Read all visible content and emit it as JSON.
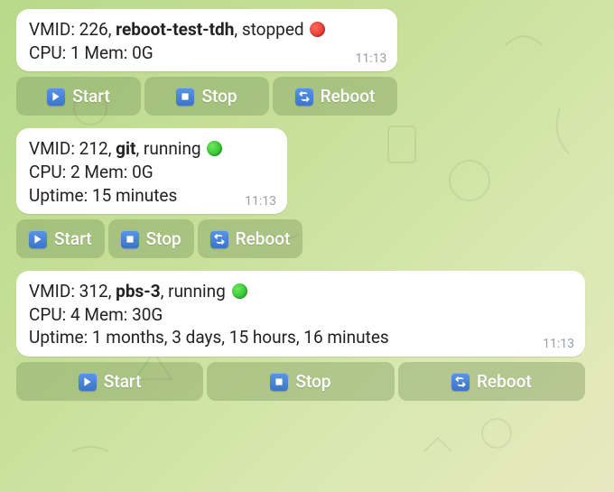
{
  "messages": [
    {
      "vmid_label": "VMID:",
      "vmid": "226",
      "name": "reboot-test-tdh",
      "status": "stopped",
      "status_color": "red",
      "cpu_label": "CPU:",
      "cpu": "1",
      "mem_label": "Mem:",
      "mem": "0G",
      "uptime_label": "",
      "uptime": "",
      "timestamp": "11:13",
      "buttons": {
        "start": "Start",
        "stop": "Stop",
        "reboot": "Reboot"
      },
      "button_style": "row1"
    },
    {
      "vmid_label": "VMID:",
      "vmid": "212",
      "name": "git",
      "status": "running",
      "status_color": "green",
      "cpu_label": "CPU:",
      "cpu": "2",
      "mem_label": "Mem:",
      "mem": "0G",
      "uptime_label": "Uptime:",
      "uptime": "15 minutes",
      "timestamp": "11:13",
      "buttons": {
        "start": "Start",
        "stop": "Stop",
        "reboot": "Reboot"
      },
      "button_style": "row2"
    },
    {
      "vmid_label": "VMID:",
      "vmid": "312",
      "name": "pbs-3",
      "status": "running",
      "status_color": "green",
      "cpu_label": "CPU:",
      "cpu": "4",
      "mem_label": "Mem:",
      "mem": "30G",
      "uptime_label": "Uptime:",
      "uptime": "1 months, 3 days, 15 hours, 16 minutes",
      "timestamp": "11:13",
      "buttons": {
        "start": "Start",
        "stop": "Stop",
        "reboot": "Reboot"
      },
      "button_style": "row-wide"
    }
  ]
}
